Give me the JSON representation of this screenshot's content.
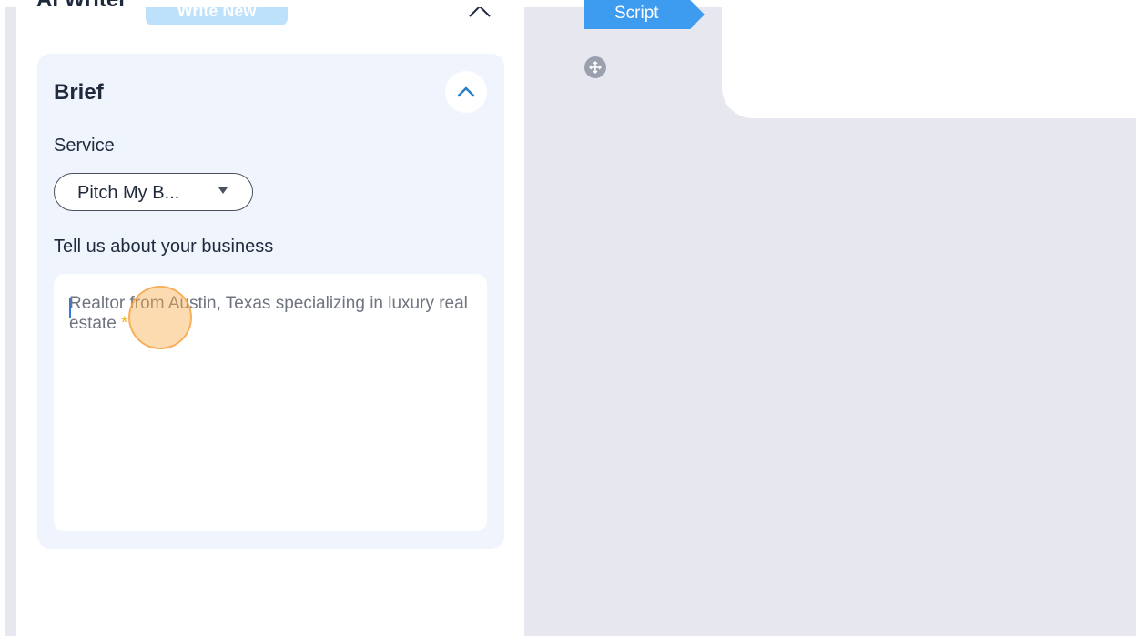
{
  "panel": {
    "title": "AI Writer",
    "write_new_label": "Write New",
    "close_icon": "close-icon"
  },
  "brief": {
    "title": "Brief",
    "collapse_icon": "chevron-up-icon",
    "service_label": "Service",
    "service_value": "Pitch My B...",
    "business_label": "Tell us about your business",
    "business_placeholder": "Realtor from Austin, Texas specializing in luxury real estate",
    "required_marker": "*"
  },
  "canvas": {
    "script_tag_label": "Script",
    "move_icon": "move-icon"
  },
  "colors": {
    "accent": "#3d9bf0",
    "write_new_bg": "#bde0fb",
    "brief_bg": "#eff4fd",
    "required": "#f0b429",
    "click_indicator": "#faaf50"
  }
}
